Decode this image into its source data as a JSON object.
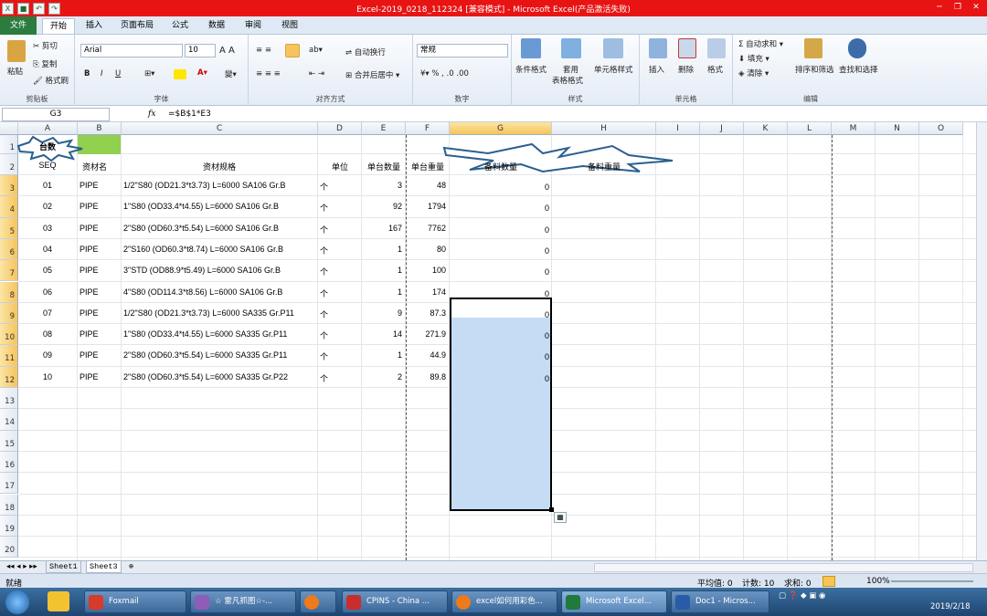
{
  "window": {
    "title": "Excel-2019_0218_112324  [兼容模式]  -  Microsoft Excel(产品激活失败)"
  },
  "tabs": [
    "文件",
    "开始",
    "插入",
    "页面布局",
    "公式",
    "数据",
    "审阅",
    "视图"
  ],
  "ribbon": {
    "clipboard": {
      "label": "剪贴板",
      "paste": "粘贴",
      "cut": "剪切",
      "copy": "复制",
      "format_painter": "格式刷"
    },
    "font": {
      "label": "字体",
      "name": "Arial",
      "size": "10",
      "bold": "B",
      "italic": "I",
      "underline": "U"
    },
    "alignment": {
      "label": "对齐方式",
      "wrap": "自动换行",
      "merge": "合并后居中"
    },
    "number": {
      "label": "数字",
      "format": "常规"
    },
    "styles": {
      "label": "样式",
      "cond": "条件格式",
      "table1": "套用",
      "table2": "表格格式",
      "cellstyle": "单元格样式"
    },
    "cells": {
      "label": "单元格",
      "insert": "插入",
      "delete": "删除",
      "format": "格式"
    },
    "editing": {
      "label": "编辑",
      "autosum": "自动求和",
      "fill": "填充",
      "clear": "清除",
      "sort": "排序和筛选",
      "find": "查找和选择"
    }
  },
  "formula_bar": {
    "name_box": "G3",
    "fx": "fx",
    "formula": "=$B$1*E3"
  },
  "columns": [
    "A",
    "B",
    "C",
    "D",
    "E",
    "F",
    "G",
    "H",
    "I",
    "J",
    "K",
    "L",
    "M",
    "N",
    "O"
  ],
  "rows": [
    "1",
    "2",
    "3",
    "4",
    "5",
    "6",
    "7",
    "8",
    "9",
    "10",
    "11",
    "12",
    "13",
    "14",
    "15",
    "16",
    "17",
    "18",
    "19",
    "20"
  ],
  "sheet": {
    "a1": "台数",
    "headers": {
      "a": "SEQ",
      "b": "资材名",
      "c": "资材规格",
      "d": "单位",
      "e": "单台数量",
      "f": "单台重量",
      "g": "备料数量",
      "h": "备料重量"
    },
    "data": [
      {
        "seq": "01",
        "name": "PIPE",
        "spec": "1/2\"S80 (OD21.3*t3.73) L=6000 SA106 Gr.B",
        "unit": "个",
        "qty": "3",
        "wt": "48",
        "g": "0"
      },
      {
        "seq": "02",
        "name": "PIPE",
        "spec": "1\"S80 (OD33.4*t4.55) L=6000 SA106 Gr.B",
        "unit": "个",
        "qty": "92",
        "wt": "1794",
        "g": "0"
      },
      {
        "seq": "03",
        "name": "PIPE",
        "spec": "2\"S80 (OD60.3*t5.54) L=6000 SA106 Gr.B",
        "unit": "个",
        "qty": "167",
        "wt": "7762",
        "g": "0"
      },
      {
        "seq": "04",
        "name": "PIPE",
        "spec": "2\"S160 (OD60.3*t8.74) L=6000 SA106 Gr.B",
        "unit": "个",
        "qty": "1",
        "wt": "80",
        "g": "0"
      },
      {
        "seq": "05",
        "name": "PIPE",
        "spec": "3\"STD (OD88.9*t5.49) L=6000 SA106 Gr.B",
        "unit": "个",
        "qty": "1",
        "wt": "100",
        "g": "0"
      },
      {
        "seq": "06",
        "name": "PIPE",
        "spec": "4\"S80 (OD114.3*t8.56) L=6000 SA106 Gr.B",
        "unit": "个",
        "qty": "1",
        "wt": "174",
        "g": "0"
      },
      {
        "seq": "07",
        "name": "PIPE",
        "spec": "1/2\"S80 (OD21.3*t3.73) L=6000 SA335 Gr.P11",
        "unit": "个",
        "qty": "9",
        "wt": "87.3",
        "g": "0"
      },
      {
        "seq": "08",
        "name": "PIPE",
        "spec": "1\"S80 (OD33.4*t4.55) L=6000 SA335 Gr.P11",
        "unit": "个",
        "qty": "14",
        "wt": "271.9",
        "g": "0"
      },
      {
        "seq": "09",
        "name": "PIPE",
        "spec": "2\"S80 (OD60.3*t5.54) L=6000 SA335 Gr.P11",
        "unit": "个",
        "qty": "1",
        "wt": "44.9",
        "g": "0"
      },
      {
        "seq": "10",
        "name": "PIPE",
        "spec": "2\"S80 (OD60.3*t5.54) L=6000 SA335 Gr.P22",
        "unit": "个",
        "qty": "2",
        "wt": "89.8",
        "g": "0"
      }
    ]
  },
  "sheet_tabs": [
    "Sheet1",
    "Sheet3"
  ],
  "status": {
    "ready": "就绪",
    "avg": "平均值: 0",
    "count": "计数: 10",
    "sum": "求和: 0",
    "zoom": "100%"
  },
  "taskbar": {
    "items": [
      "Foxmail",
      "☆ 雷凡抓图☆-...",
      "",
      "CPINS - China ...",
      "excel如何用彩色...",
      "Microsoft Excel...",
      "Doc1 - Micros..."
    ],
    "clock": "2019/2/18"
  },
  "colors": {
    "title": "#e81414",
    "accent": "#2b7c3e",
    "selection": "#c6dcf5",
    "b1": "#92d050"
  }
}
